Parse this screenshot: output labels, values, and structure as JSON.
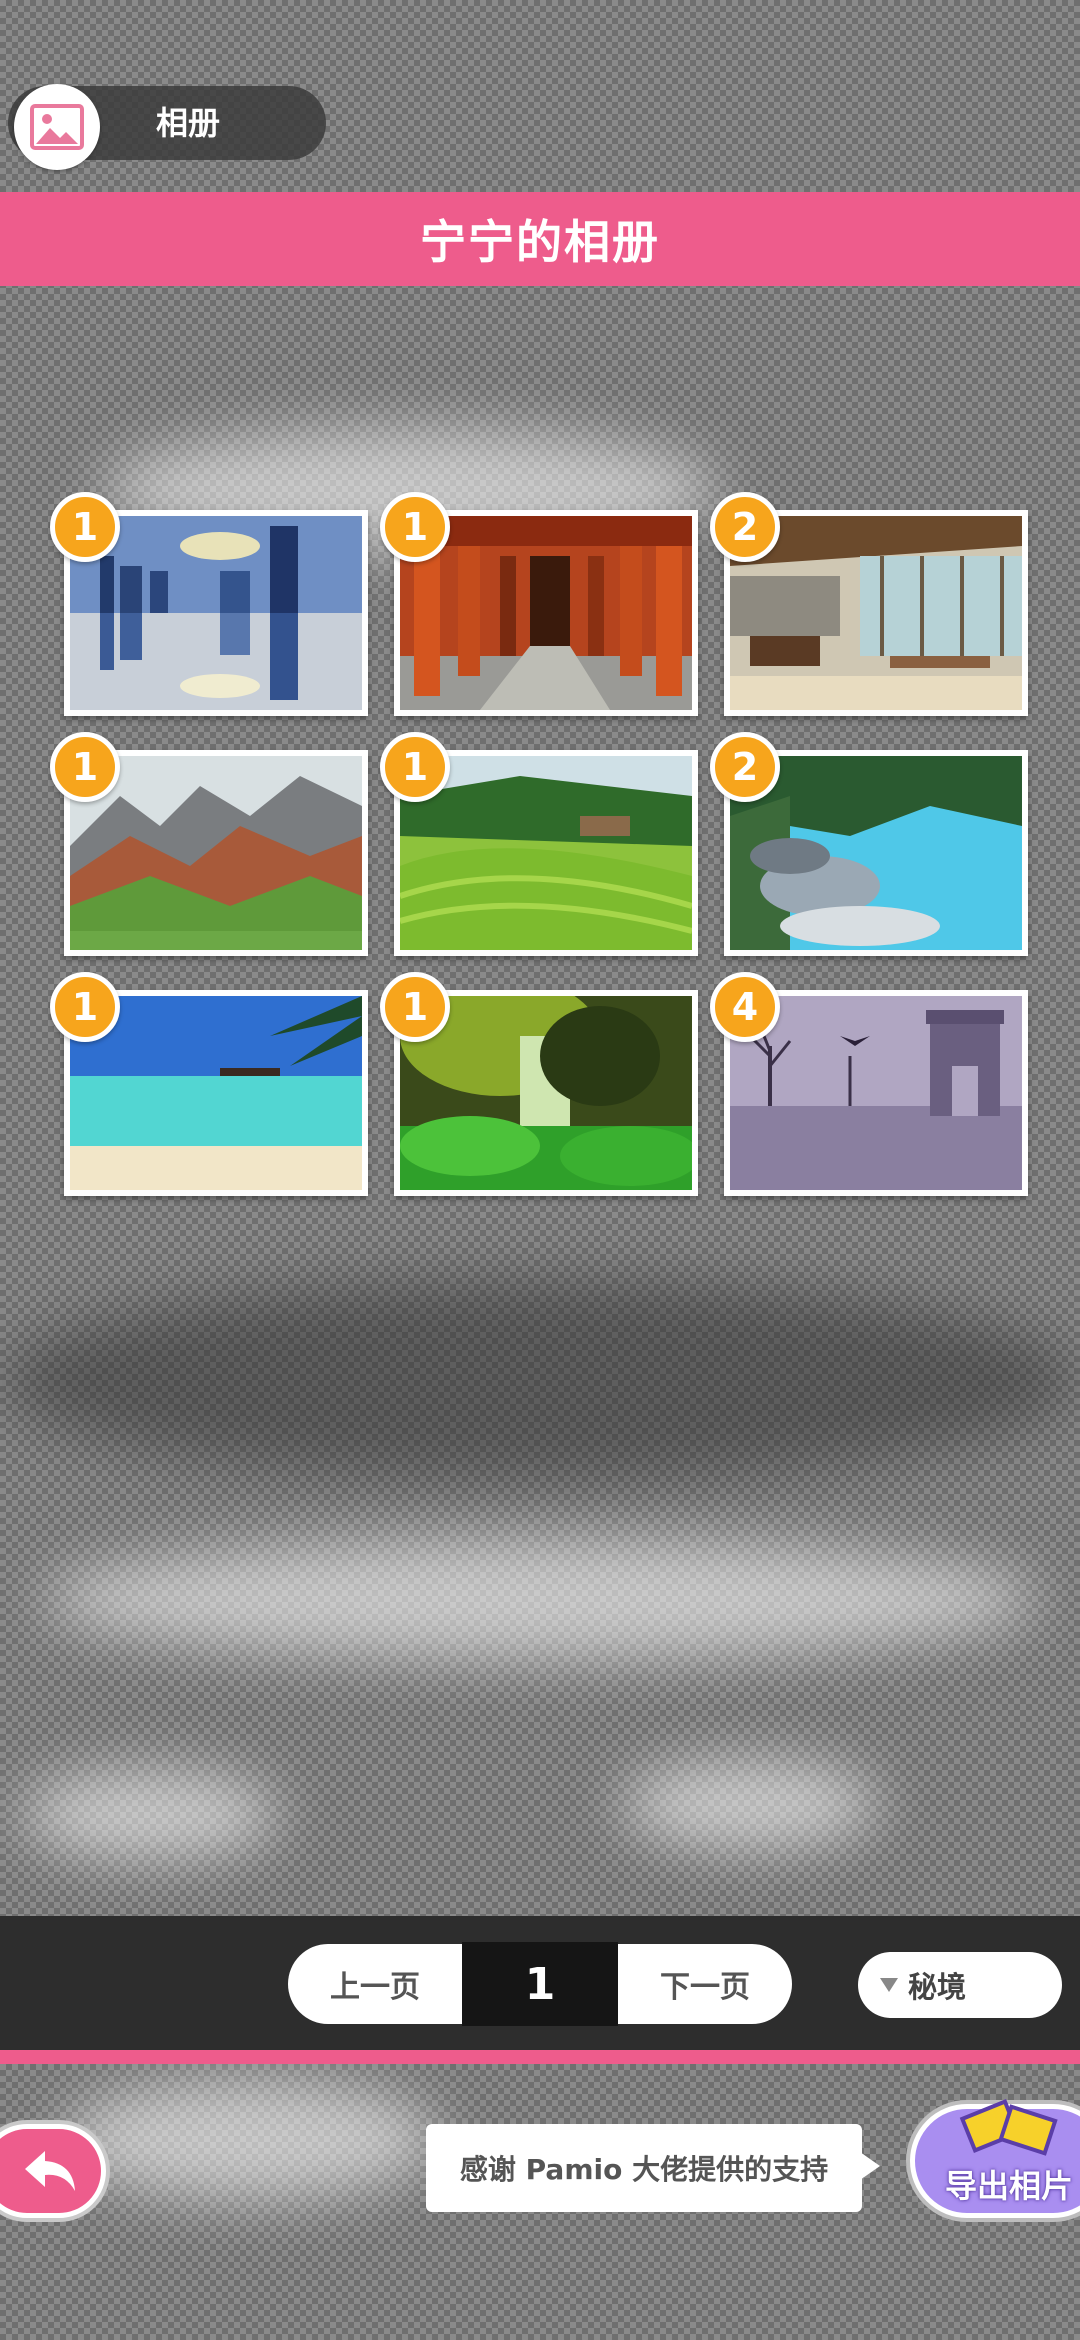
{
  "header": {
    "album_label": "相册",
    "title": "宁宁的相册"
  },
  "photos": [
    {
      "count": "1",
      "scene": "city-reflection"
    },
    {
      "count": "1",
      "scene": "torii-corridor"
    },
    {
      "count": "2",
      "scene": "cafe-interior"
    },
    {
      "count": "1",
      "scene": "mountains"
    },
    {
      "count": "1",
      "scene": "rice-terraces"
    },
    {
      "count": "2",
      "scene": "blue-lake"
    },
    {
      "count": "1",
      "scene": "tropical-beach"
    },
    {
      "count": "1",
      "scene": "forest-waterfall"
    },
    {
      "count": "4",
      "scene": "arc-de-triomphe"
    }
  ],
  "pagination": {
    "prev_label": "上一页",
    "page_number": "1",
    "next_label": "下一页"
  },
  "filter": {
    "selected": "秘境"
  },
  "footer": {
    "credits": "感谢 Pamio 大佬提供的支持",
    "export_label": "导出相片"
  },
  "colors": {
    "accent_pink": "#ee5c8c",
    "badge_orange": "#f7a51c",
    "export_purple": "#a98ef0"
  }
}
